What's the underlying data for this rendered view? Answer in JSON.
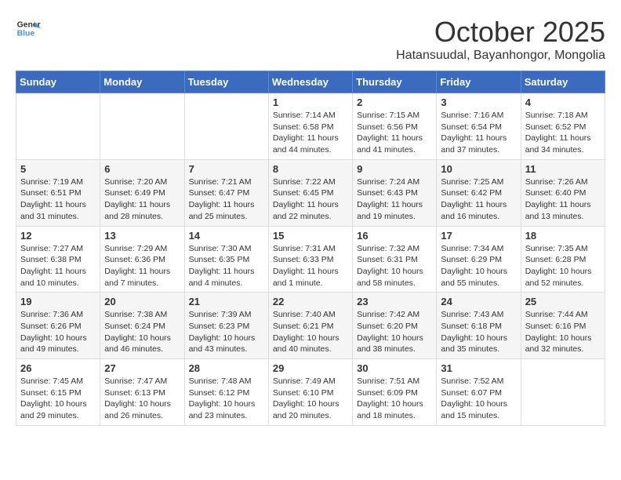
{
  "header": {
    "logo_line1": "General",
    "logo_line2": "Blue",
    "month_title": "October 2025",
    "location": "Hatansuudal, Bayanhongor, Mongolia"
  },
  "weekdays": [
    "Sunday",
    "Monday",
    "Tuesday",
    "Wednesday",
    "Thursday",
    "Friday",
    "Saturday"
  ],
  "weeks": [
    [
      {
        "day": "",
        "info": ""
      },
      {
        "day": "",
        "info": ""
      },
      {
        "day": "",
        "info": ""
      },
      {
        "day": "1",
        "info": "Sunrise: 7:14 AM\nSunset: 6:58 PM\nDaylight: 11 hours\nand 44 minutes."
      },
      {
        "day": "2",
        "info": "Sunrise: 7:15 AM\nSunset: 6:56 PM\nDaylight: 11 hours\nand 41 minutes."
      },
      {
        "day": "3",
        "info": "Sunrise: 7:16 AM\nSunset: 6:54 PM\nDaylight: 11 hours\nand 37 minutes."
      },
      {
        "day": "4",
        "info": "Sunrise: 7:18 AM\nSunset: 6:52 PM\nDaylight: 11 hours\nand 34 minutes."
      }
    ],
    [
      {
        "day": "5",
        "info": "Sunrise: 7:19 AM\nSunset: 6:51 PM\nDaylight: 11 hours\nand 31 minutes."
      },
      {
        "day": "6",
        "info": "Sunrise: 7:20 AM\nSunset: 6:49 PM\nDaylight: 11 hours\nand 28 minutes."
      },
      {
        "day": "7",
        "info": "Sunrise: 7:21 AM\nSunset: 6:47 PM\nDaylight: 11 hours\nand 25 minutes."
      },
      {
        "day": "8",
        "info": "Sunrise: 7:22 AM\nSunset: 6:45 PM\nDaylight: 11 hours\nand 22 minutes."
      },
      {
        "day": "9",
        "info": "Sunrise: 7:24 AM\nSunset: 6:43 PM\nDaylight: 11 hours\nand 19 minutes."
      },
      {
        "day": "10",
        "info": "Sunrise: 7:25 AM\nSunset: 6:42 PM\nDaylight: 11 hours\nand 16 minutes."
      },
      {
        "day": "11",
        "info": "Sunrise: 7:26 AM\nSunset: 6:40 PM\nDaylight: 11 hours\nand 13 minutes."
      }
    ],
    [
      {
        "day": "12",
        "info": "Sunrise: 7:27 AM\nSunset: 6:38 PM\nDaylight: 11 hours\nand 10 minutes."
      },
      {
        "day": "13",
        "info": "Sunrise: 7:29 AM\nSunset: 6:36 PM\nDaylight: 11 hours\nand 7 minutes."
      },
      {
        "day": "14",
        "info": "Sunrise: 7:30 AM\nSunset: 6:35 PM\nDaylight: 11 hours\nand 4 minutes."
      },
      {
        "day": "15",
        "info": "Sunrise: 7:31 AM\nSunset: 6:33 PM\nDaylight: 11 hours\nand 1 minute."
      },
      {
        "day": "16",
        "info": "Sunrise: 7:32 AM\nSunset: 6:31 PM\nDaylight: 10 hours\nand 58 minutes."
      },
      {
        "day": "17",
        "info": "Sunrise: 7:34 AM\nSunset: 6:29 PM\nDaylight: 10 hours\nand 55 minutes."
      },
      {
        "day": "18",
        "info": "Sunrise: 7:35 AM\nSunset: 6:28 PM\nDaylight: 10 hours\nand 52 minutes."
      }
    ],
    [
      {
        "day": "19",
        "info": "Sunrise: 7:36 AM\nSunset: 6:26 PM\nDaylight: 10 hours\nand 49 minutes."
      },
      {
        "day": "20",
        "info": "Sunrise: 7:38 AM\nSunset: 6:24 PM\nDaylight: 10 hours\nand 46 minutes."
      },
      {
        "day": "21",
        "info": "Sunrise: 7:39 AM\nSunset: 6:23 PM\nDaylight: 10 hours\nand 43 minutes."
      },
      {
        "day": "22",
        "info": "Sunrise: 7:40 AM\nSunset: 6:21 PM\nDaylight: 10 hours\nand 40 minutes."
      },
      {
        "day": "23",
        "info": "Sunrise: 7:42 AM\nSunset: 6:20 PM\nDaylight: 10 hours\nand 38 minutes."
      },
      {
        "day": "24",
        "info": "Sunrise: 7:43 AM\nSunset: 6:18 PM\nDaylight: 10 hours\nand 35 minutes."
      },
      {
        "day": "25",
        "info": "Sunrise: 7:44 AM\nSunset: 6:16 PM\nDaylight: 10 hours\nand 32 minutes."
      }
    ],
    [
      {
        "day": "26",
        "info": "Sunrise: 7:45 AM\nSunset: 6:15 PM\nDaylight: 10 hours\nand 29 minutes."
      },
      {
        "day": "27",
        "info": "Sunrise: 7:47 AM\nSunset: 6:13 PM\nDaylight: 10 hours\nand 26 minutes."
      },
      {
        "day": "28",
        "info": "Sunrise: 7:48 AM\nSunset: 6:12 PM\nDaylight: 10 hours\nand 23 minutes."
      },
      {
        "day": "29",
        "info": "Sunrise: 7:49 AM\nSunset: 6:10 PM\nDaylight: 10 hours\nand 20 minutes."
      },
      {
        "day": "30",
        "info": "Sunrise: 7:51 AM\nSunset: 6:09 PM\nDaylight: 10 hours\nand 18 minutes."
      },
      {
        "day": "31",
        "info": "Sunrise: 7:52 AM\nSunset: 6:07 PM\nDaylight: 10 hours\nand 15 minutes."
      },
      {
        "day": "",
        "info": ""
      }
    ]
  ]
}
